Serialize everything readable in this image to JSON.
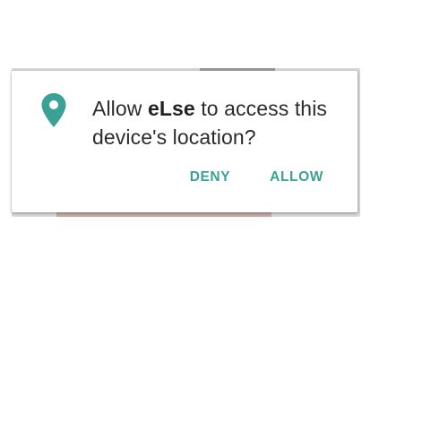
{
  "dialog": {
    "icon": "location-pin-icon",
    "message_prefix": "Allow ",
    "app_name": "eLse",
    "message_suffix": " to access this device's location?",
    "deny_label": "DENY",
    "allow_label": "ALLOW"
  },
  "colors": {
    "accent": "#3aa197",
    "text": "#2b2b2b",
    "surface": "#ffffff"
  }
}
